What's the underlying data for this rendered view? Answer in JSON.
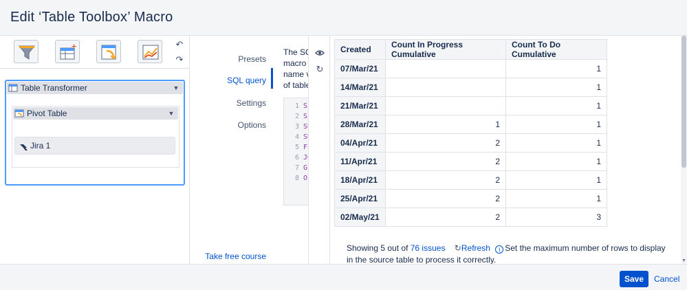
{
  "dialog": {
    "title": "Edit ‘Table Toolbox’ Macro"
  },
  "toolbar": {
    "icons": [
      "filter-icon",
      "add-table-icon",
      "pivot-icon",
      "chart-icon"
    ],
    "undo_icon": "undo-icon",
    "redo_icon": "redo-icon"
  },
  "macro_tree": {
    "table_transformer": {
      "label": "Table Transformer",
      "icon": "table-transformer-icon"
    },
    "pivot_table": {
      "label": "Pivot Table",
      "icon": "pivot-table-icon"
    },
    "jira": {
      "label": "Jira 1",
      "icon": "jira-icon"
    }
  },
  "nav": {
    "items": [
      {
        "label": "Presets",
        "active": false
      },
      {
        "label": "SQL query",
        "active": true
      },
      {
        "label": "Settings",
        "active": false
      },
      {
        "label": "Options",
        "active": false
      }
    ],
    "course_link": "Take free course"
  },
  "sql_panel": {
    "description_lines": [
      "The SQ",
      "macro V",
      "name v",
      "of table"
    ],
    "line_numbers": [
      "1",
      "2",
      "3",
      "4",
      "5",
      "6",
      "7",
      "8"
    ],
    "code_lines": [
      "SI",
      "SI",
      "SU",
      "SU",
      "FI",
      "JO",
      "G",
      "O"
    ]
  },
  "preview_icons": [
    "eye-icon",
    "refresh-icon"
  ],
  "table": {
    "columns": [
      "Created",
      "Count In Progress Cumulative",
      "Count To Do Cumulative"
    ],
    "rows": [
      {
        "created": "07/Mar/21",
        "in_progress": "",
        "to_do": "1"
      },
      {
        "created": "14/Mar/21",
        "in_progress": "",
        "to_do": "1"
      },
      {
        "created": "21/Mar/21",
        "in_progress": "",
        "to_do": "1"
      },
      {
        "created": "28/Mar/21",
        "in_progress": "1",
        "to_do": "1"
      },
      {
        "created": "04/Apr/21",
        "in_progress": "2",
        "to_do": "1"
      },
      {
        "created": "11/Apr/21",
        "in_progress": "2",
        "to_do": "1"
      },
      {
        "created": "18/Apr/21",
        "in_progress": "2",
        "to_do": "1"
      },
      {
        "created": "25/Apr/21",
        "in_progress": "2",
        "to_do": "1"
      },
      {
        "created": "02/May/21",
        "in_progress": "2",
        "to_do": "3"
      }
    ]
  },
  "footer": {
    "showing_prefix": "Showing 5 out of",
    "issues_link": "76 issues",
    "refresh_label": "Refresh",
    "info_text": "Set the maximum number of rows to display in the source table to process it correctly."
  },
  "buttons": {
    "save": "Save",
    "cancel": "Cancel"
  },
  "colors": {
    "accent": "#0052cc",
    "selection_border": "#4c9aff",
    "code_keyword": "#8b3aa6"
  }
}
